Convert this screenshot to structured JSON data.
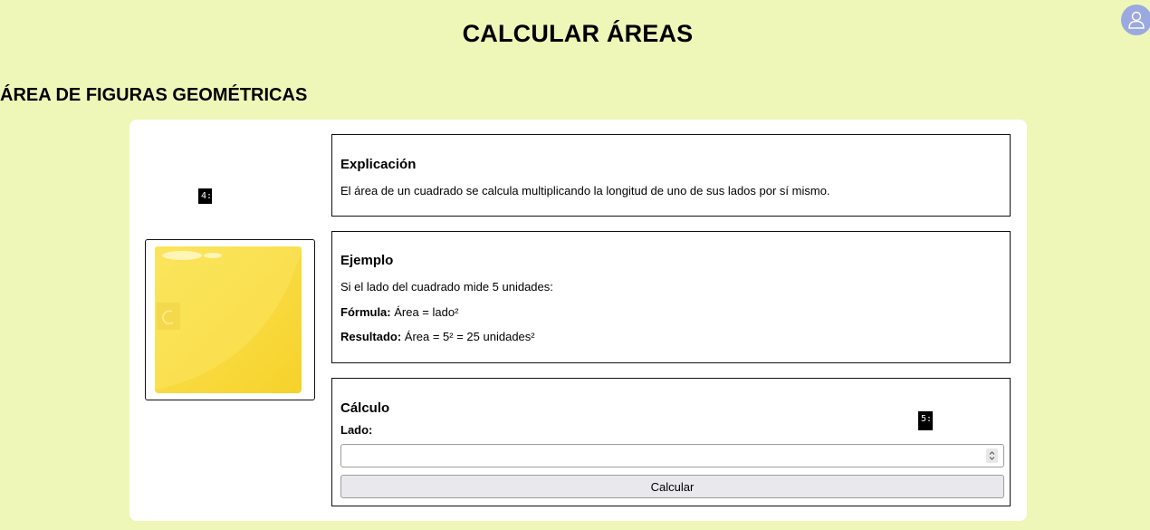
{
  "header": {
    "title": "CALCULAR ÁREAS",
    "user_icon": "user-icon",
    "avatar_color": "#9aa9df"
  },
  "section": {
    "title": "ÁREA DE FIGURAS GEOMÉTRICAS"
  },
  "figure": {
    "shape": "square",
    "shape_icon": "refresh-icon",
    "fill_color": "#f8d838"
  },
  "badges": {
    "figure_badge": "4:",
    "calc_badge": "5:"
  },
  "explicacion": {
    "title": "Explicación",
    "text": "El área de un cuadrado se calcula multiplicando la longitud de uno de sus lados por sí mismo."
  },
  "ejemplo": {
    "title": "Ejemplo",
    "intro": "Si el lado del cuadrado mide 5 unidades:",
    "formula_label": "Fórmula:",
    "formula_value": " Área = lado²",
    "result_label": "Resultado:",
    "result_value": " Área = 5² = 25 unidades²"
  },
  "calculo": {
    "title": "Cálculo",
    "side_label": "Lado:",
    "side_value": "",
    "button_label": "Calcular"
  },
  "colors": {
    "background": "#eef7b8",
    "card": "#ffffff",
    "button": "#e9e9ed"
  }
}
